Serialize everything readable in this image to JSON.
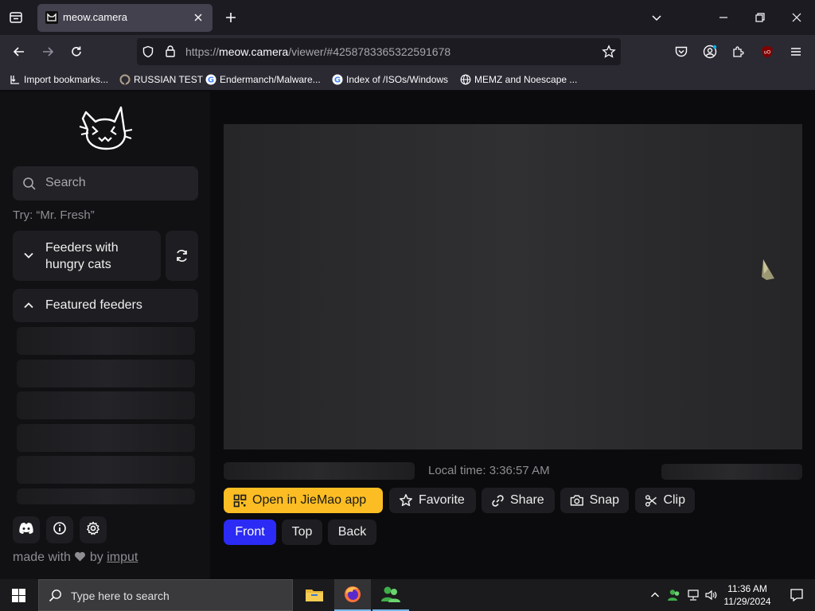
{
  "browser": {
    "tab_title": "meow.camera",
    "url_prefix": "https://",
    "url_host": "meow.camera",
    "url_path": "/viewer/#4258783365322591678",
    "bookmarks": [
      {
        "label": "Import bookmarks...",
        "icon": "import-icon"
      },
      {
        "label": "RUSSIAN TEST",
        "icon": "site-icon"
      },
      {
        "label": "Endermanch/Malware...",
        "icon": "google-icon"
      },
      {
        "label": "Index of /ISOs/Windows",
        "icon": "google-icon"
      },
      {
        "label": "MEMZ and Noescape ...",
        "icon": "globe-icon"
      }
    ]
  },
  "sidebar": {
    "search_placeholder": "Search",
    "try_hint": "Try: “Mr. Fresh”",
    "feeders_label": "Feeders with hungry cats",
    "featured_label": "Featured feeders",
    "made_with_prefix": "made with",
    "made_with_by": "by",
    "made_with_link": "imput"
  },
  "viewer": {
    "local_time": "Local time: 3:36:57 AM",
    "actions": {
      "jiemao": "Open in JieMao app",
      "favorite": "Favorite",
      "share": "Share",
      "snap": "Snap",
      "clip": "Clip"
    },
    "views": {
      "front": "Front",
      "top": "Top",
      "back": "Back"
    },
    "selected_view": "Front"
  },
  "taskbar": {
    "search_placeholder": "Type here to search",
    "time": "11:36 AM",
    "date": "11/29/2024"
  },
  "colors": {
    "accent_yellow": "#fbbd23",
    "accent_blue": "#2b2bf5"
  }
}
